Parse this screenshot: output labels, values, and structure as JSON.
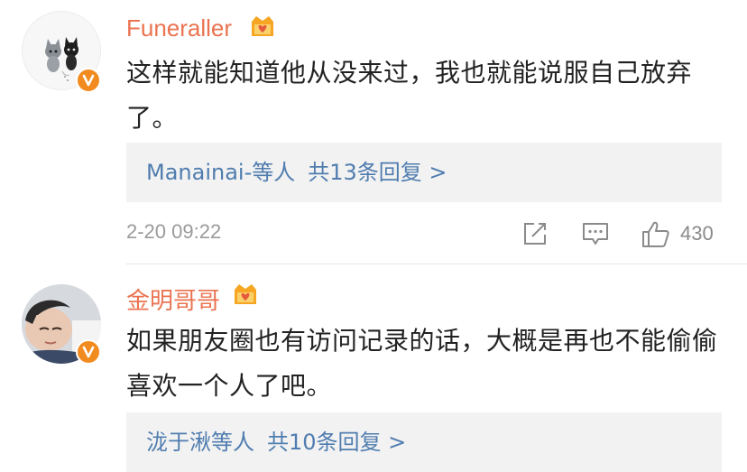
{
  "comments": [
    {
      "username": "Funeraller",
      "text": "这样就能知道他从没来过，我也就能说服自己放弃了。",
      "reply_users": "Manainai-等人",
      "reply_count": "共13条回复 >",
      "time": "2-20 09:22",
      "likes": "430",
      "icons": [
        "vip-crown-icon",
        "verified-v-badge",
        "share-icon",
        "comment-icon",
        "like-icon"
      ]
    },
    {
      "username": "金明哥哥",
      "text": "如果朋友圈也有访问记录的话，大概是再也不能偷偷喜欢一个人了吧。",
      "reply_users": "泷于湫等人",
      "reply_count": "共10条回复 >",
      "icons": [
        "vip-crown-icon",
        "verified-v-badge"
      ]
    }
  ],
  "colors": {
    "username": "#eb7350",
    "reply_link": "#507daf",
    "reply_bg": "#f2f2f2",
    "badge": "#f28b1f",
    "meta": "#9a9a9a"
  }
}
